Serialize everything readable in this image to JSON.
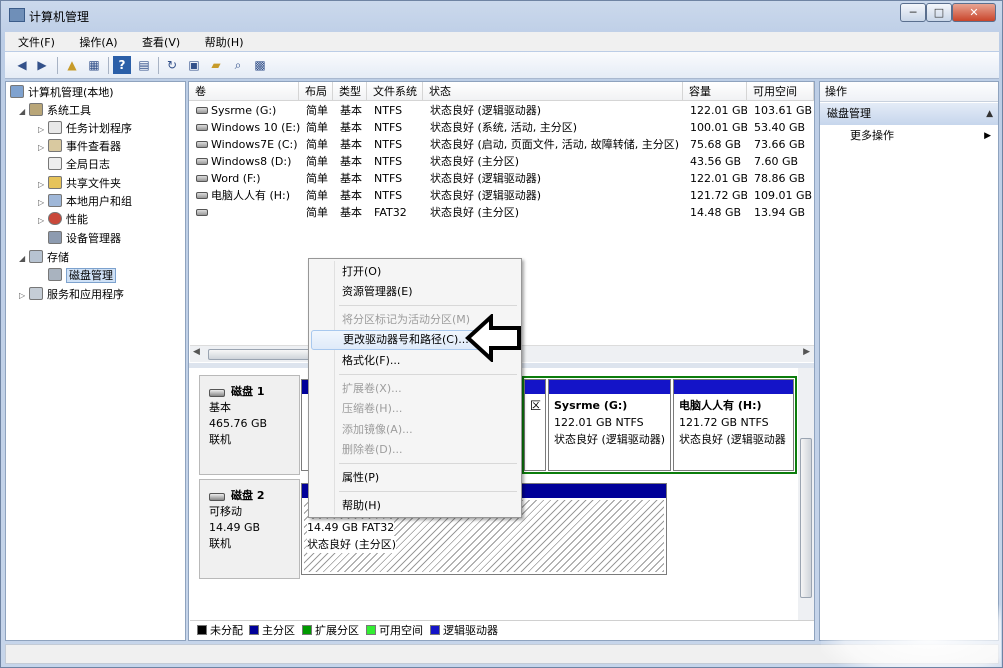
{
  "window": {
    "title": "计算机管理",
    "min": "─",
    "max": "□",
    "close": "✕"
  },
  "menu": [
    {
      "label": "文件(F)"
    },
    {
      "label": "操作(A)"
    },
    {
      "label": "查看(V)"
    },
    {
      "label": "帮助(H)"
    }
  ],
  "tree": {
    "root": "计算机管理(本地)",
    "system_tools": "系统工具",
    "task_scheduler": "任务计划程序",
    "event_viewer": "事件查看器",
    "global_log": "全局日志",
    "shared_folders": "共享文件夹",
    "local_users": "本地用户和组",
    "performance": "性能",
    "device_manager": "设备管理器",
    "storage": "存储",
    "disk_management": "磁盘管理",
    "services_apps": "服务和应用程序"
  },
  "columns": {
    "volume": "卷",
    "layout": "布局",
    "type": "类型",
    "fs": "文件系统",
    "status": "状态",
    "capacity": "容量",
    "free": "可用空间"
  },
  "volumes": [
    {
      "name": "Sysrme (G:)",
      "layout": "简单",
      "type": "基本",
      "fs": "NTFS",
      "status": "状态良好 (逻辑驱动器)",
      "capacity": "122.01 GB",
      "free": "103.61 GB"
    },
    {
      "name": "Windows 10 (E:)",
      "layout": "简单",
      "type": "基本",
      "fs": "NTFS",
      "status": "状态良好 (系统, 活动, 主分区)",
      "capacity": "100.01 GB",
      "free": "53.40 GB"
    },
    {
      "name": "Windows7E (C:)",
      "layout": "简单",
      "type": "基本",
      "fs": "NTFS",
      "status": "状态良好 (启动, 页面文件, 活动, 故障转储, 主分区)",
      "capacity": "75.68 GB",
      "free": "73.66 GB"
    },
    {
      "name": "Windows8 (D:)",
      "layout": "简单",
      "type": "基本",
      "fs": "NTFS",
      "status": "状态良好 (主分区)",
      "capacity": "43.56 GB",
      "free": "7.60 GB"
    },
    {
      "name": "Word (F:)",
      "layout": "简单",
      "type": "基本",
      "fs": "NTFS",
      "status": "状态良好 (逻辑驱动器)",
      "capacity": "122.01 GB",
      "free": "78.86 GB"
    },
    {
      "name": "电脑人人有 (H:)",
      "layout": "简单",
      "type": "基本",
      "fs": "NTFS",
      "status": "状态良好 (逻辑驱动器)",
      "capacity": "121.72 GB",
      "free": "109.01 GB"
    },
    {
      "name": "",
      "layout": "简单",
      "type": "基本",
      "fs": "FAT32",
      "status": "状态良好 (主分区)",
      "capacity": "14.48 GB",
      "free": "13.94 GB"
    }
  ],
  "disk1": {
    "name": "磁盘 1",
    "type": "基本",
    "size": "465.76 GB",
    "state": "联机",
    "p_left_status": "B",
    "p_right_status": "区",
    "p_g_title": "Sysrme  (G:)",
    "p_g_size": "122.01 GB NTFS",
    "p_g_status": "状态良好 (逻辑驱动器)",
    "p_h_title": "电脑人人有  (H:)",
    "p_h_size": "121.72 GB NTFS",
    "p_h_status": "状态良好 (逻辑驱动器"
  },
  "disk2": {
    "name": "磁盘 2",
    "type": "可移动",
    "size": "14.49 GB",
    "state": "联机",
    "p_size": "14.49 GB FAT32",
    "p_status": "状态良好 (主分区)"
  },
  "legend": [
    {
      "label": "未分配",
      "color": "#000000"
    },
    {
      "label": "主分区",
      "color": "#000099"
    },
    {
      "label": "扩展分区",
      "color": "#009900"
    },
    {
      "label": "可用空间",
      "color": "#33ee33"
    },
    {
      "label": "逻辑驱动器",
      "color": "#1414c8"
    }
  ],
  "actions": {
    "title": "操作",
    "section": "磁盘管理",
    "more": "更多操作"
  },
  "context_menu": {
    "open": "打开(O)",
    "explorer": "资源管理器(E)",
    "mark_active": "将分区标记为活动分区(M)",
    "change_letter": "更改驱动器号和路径(C)...",
    "format": "格式化(F)...",
    "extend": "扩展卷(X)...",
    "shrink": "压缩卷(H)...",
    "add_mirror": "添加镜像(A)...",
    "delete": "删除卷(D)...",
    "properties": "属性(P)",
    "help": "帮助(H)"
  }
}
